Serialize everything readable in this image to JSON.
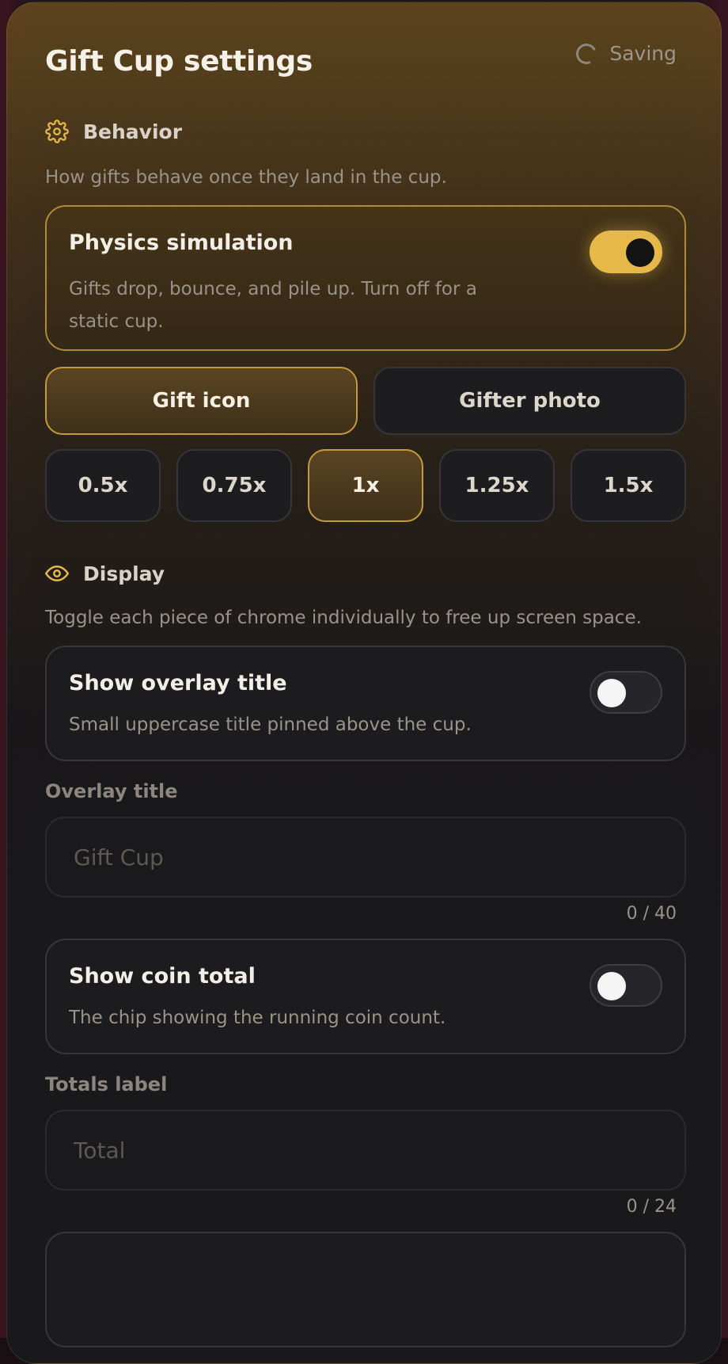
{
  "header": {
    "title": "Gift Cup settings",
    "status": "Saving"
  },
  "behavior": {
    "heading": "Behavior",
    "description": "How gifts behave once they land in the cup.",
    "physics": {
      "title": "Physics simulation",
      "description": "Gifts drop, bounce, and pile up. Turn off for a static cup.",
      "enabled": true
    },
    "display_mode": {
      "options": [
        "Gift icon",
        "Gifter photo"
      ],
      "selected": "Gift icon"
    },
    "scale": {
      "options": [
        "0.5x",
        "0.75x",
        "1x",
        "1.25x",
        "1.5x"
      ],
      "selected": "1x"
    }
  },
  "display": {
    "heading": "Display",
    "description": "Toggle each piece of chrome individually to free up screen space.",
    "overlay_title_toggle": {
      "title": "Show overlay title",
      "description": "Small uppercase title pinned above the cup.",
      "enabled": false
    },
    "overlay_title_field": {
      "label": "Overlay title",
      "value": "",
      "placeholder": "Gift Cup",
      "counter": "0 / 40"
    },
    "coin_total_toggle": {
      "title": "Show coin total",
      "description": "The chip showing the running coin count.",
      "enabled": false
    },
    "totals_label_field": {
      "label": "Totals label",
      "value": "",
      "placeholder": "Total",
      "counter": "0 / 24"
    }
  },
  "colors": {
    "accent": "#e6b84a",
    "card_border_active": "#b08a3a"
  }
}
